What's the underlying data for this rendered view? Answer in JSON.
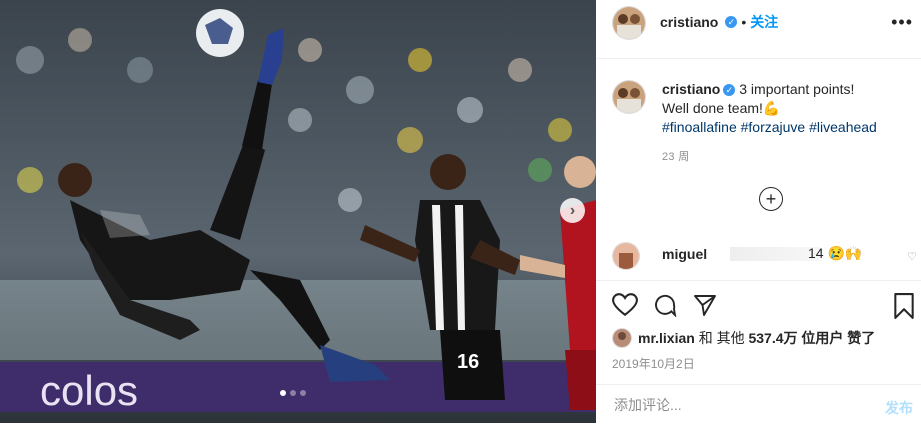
{
  "post": {
    "author": "cristiano",
    "follow_label": "关注",
    "more_icon": "ellipsis-icon",
    "caption": {
      "author": "cristiano",
      "line1": "3 important points!",
      "line2": "Well done team!💪",
      "hashtags": [
        "#finoallafine",
        "#forzajuve",
        "#liveahead"
      ],
      "age": "23 周"
    },
    "comment": {
      "user": "miguel",
      "text": "14 😢🙌"
    },
    "likes": {
      "liked_by": "mr.lixian",
      "connector": "和 其他",
      "count": "537.4万",
      "suffix": "位用户 赞了"
    },
    "date": "2019年10月2日",
    "add_comment": {
      "placeholder": "添加评论...",
      "post_label": "发布"
    },
    "photo": {
      "jersey_number": "16",
      "banner_text": "colos",
      "carousel_index": 0,
      "carousel_count": 3
    }
  },
  "colors": {
    "accent": "#0095f6",
    "verified": "#3897f0",
    "hashtag": "#00376b",
    "muted": "#8e8e8e",
    "post_disabled": "#b2dffc"
  }
}
